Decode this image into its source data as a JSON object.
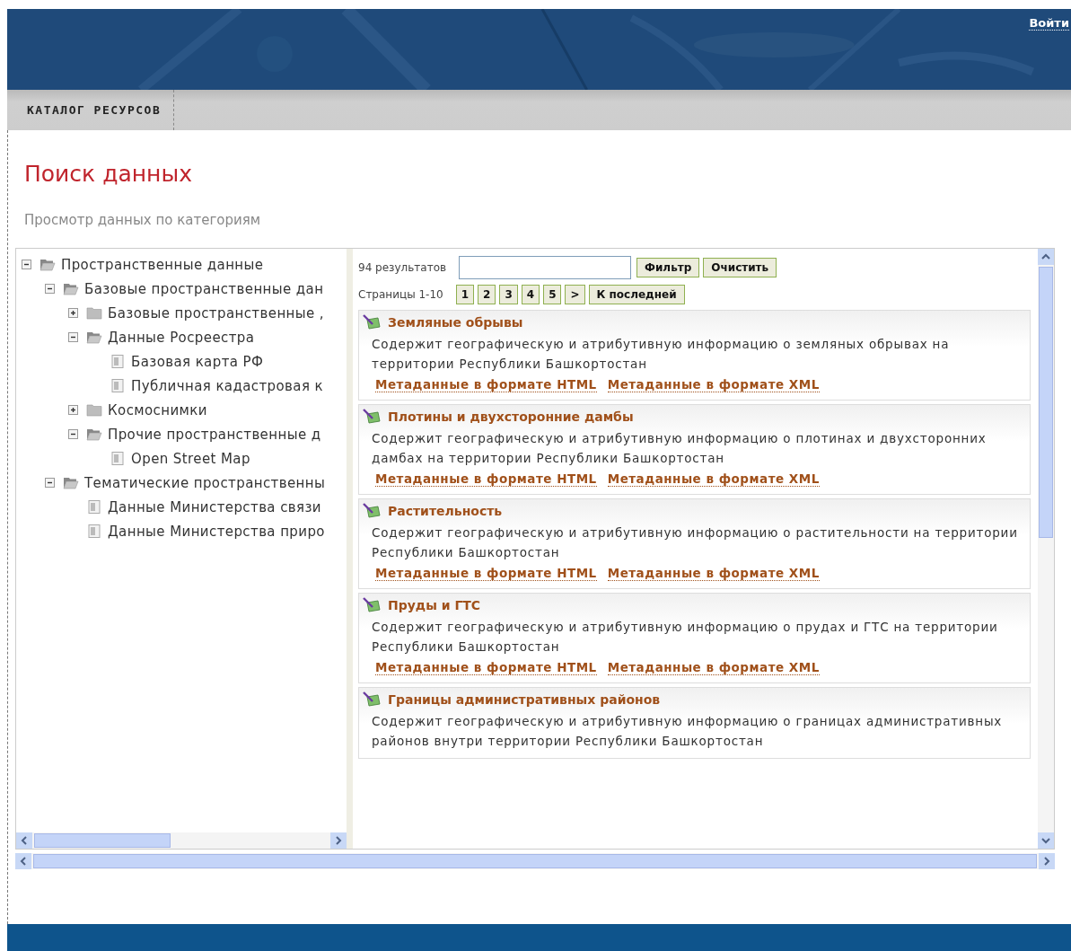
{
  "header": {
    "login_link": "Войти"
  },
  "nav": {
    "items": [
      {
        "label": "КАТАЛОГ РЕСУРСОВ"
      }
    ]
  },
  "page_title": "Поиск данных",
  "section_title": "Просмотр данных по категориям",
  "tree": [
    {
      "label": "Пространственные данные",
      "kind": "folder",
      "expanded": true,
      "children": [
        {
          "label": "Базовые пространственные дан",
          "kind": "folder",
          "expanded": true,
          "children": [
            {
              "label": "Базовые пространственные ,",
              "kind": "folder",
              "expanded": false
            },
            {
              "label": "Данные Росреестра",
              "kind": "folder",
              "expanded": true,
              "children": [
                {
                  "label": "Базовая карта РФ",
                  "kind": "leaf"
                },
                {
                  "label": "Публичная кадастровая к",
                  "kind": "leaf"
                }
              ]
            },
            {
              "label": "Космоснимки",
              "kind": "folder",
              "expanded": false
            },
            {
              "label": "Прочие пространственные д",
              "kind": "folder",
              "expanded": true,
              "children": [
                {
                  "label": "Open Street Map",
                  "kind": "leaf"
                }
              ]
            }
          ]
        },
        {
          "label": "Тематические пространственны",
          "kind": "folder",
          "expanded": true,
          "children": [
            {
              "label": "Данные Министерства связи",
              "kind": "leaf"
            },
            {
              "label": "Данные Министерства приро",
              "kind": "leaf"
            }
          ]
        }
      ]
    }
  ],
  "results": {
    "count": "94 результатов",
    "filter_button": "Фильтр",
    "clear_button": "Очистить",
    "pages_label": "Страницы 1-10",
    "pages": [
      "1",
      "2",
      "3",
      "4",
      "5",
      ">"
    ],
    "last_button": "К последней",
    "items": [
      {
        "title": "Земляные обрывы",
        "description": "Содержит географическую и атрибутивную информацию о земляных обрывах на территории Республики Башкортостан",
        "links": [
          "Метаданные в формате HTML",
          "Метаданные в формате XML"
        ]
      },
      {
        "title": "Плотины и двухсторонние дамбы",
        "description": "Содержит географическую и атрибутивную информацию о плотинах и двухсторонних дамбах на территории Республики Башкортостан",
        "links": [
          "Метаданные в формате HTML",
          "Метаданные в формате XML"
        ]
      },
      {
        "title": "Растительность",
        "description": "Содержит географическую и атрибутивную информацию о растительности на территории Республики Башкортостан",
        "links": [
          "Метаданные в формате HTML",
          "Метаданные в формате XML"
        ]
      },
      {
        "title": "Пруды и ГТС",
        "description": "Содержит географическую и атрибутивную информацию о прудах и ГТС на территории Республики Башкортостан",
        "links": [
          "Метаданные в формате HTML",
          "Метаданные в формате XML"
        ]
      },
      {
        "title": "Границы административных районов",
        "description": "Содержит географическую и атрибутивную информацию о границах административных районов внутри территории Республики Башкортостан"
      }
    ]
  }
}
